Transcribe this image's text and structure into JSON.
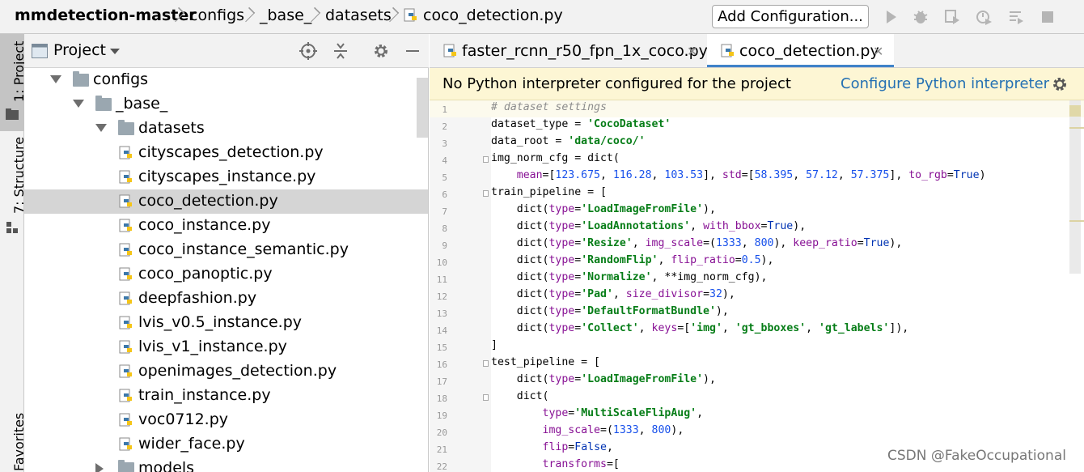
{
  "nav": {
    "crumbs": [
      "mmdetection-master",
      "configs",
      "_base_",
      "datasets",
      "coco_detection.py"
    ],
    "add_configuration": "Add Configuration..."
  },
  "toolbar_icons": [
    "run-icon",
    "debug-icon",
    "coverage-icon",
    "profile-icon",
    "build-icon",
    "stop-icon"
  ],
  "sidebar": {
    "tab_project": "1: Project",
    "tab_structure": "7: Structure",
    "tab_favorites": "Favorites"
  },
  "project": {
    "title": "Project",
    "tree": [
      {
        "label": "configs",
        "type": "folder",
        "expanded": true,
        "depth": 0
      },
      {
        "label": "_base_",
        "type": "folder",
        "expanded": true,
        "depth": 1
      },
      {
        "label": "datasets",
        "type": "folder",
        "expanded": true,
        "depth": 2
      },
      {
        "label": "cityscapes_detection.py",
        "type": "py",
        "depth": 3
      },
      {
        "label": "cityscapes_instance.py",
        "type": "py",
        "depth": 3
      },
      {
        "label": "coco_detection.py",
        "type": "py",
        "depth": 3,
        "selected": true
      },
      {
        "label": "coco_instance.py",
        "type": "py",
        "depth": 3
      },
      {
        "label": "coco_instance_semantic.py",
        "type": "py",
        "depth": 3
      },
      {
        "label": "coco_panoptic.py",
        "type": "py",
        "depth": 3
      },
      {
        "label": "deepfashion.py",
        "type": "py",
        "depth": 3
      },
      {
        "label": "lvis_v0.5_instance.py",
        "type": "py",
        "depth": 3
      },
      {
        "label": "lvis_v1_instance.py",
        "type": "py",
        "depth": 3
      },
      {
        "label": "openimages_detection.py",
        "type": "py",
        "depth": 3
      },
      {
        "label": "train_instance.py",
        "type": "py",
        "depth": 3
      },
      {
        "label": "voc0712.py",
        "type": "py",
        "depth": 3
      },
      {
        "label": "wider_face.py",
        "type": "py",
        "depth": 3
      },
      {
        "label": "models",
        "type": "folder",
        "expanded": false,
        "depth": 2
      }
    ]
  },
  "tabs": [
    {
      "label": "faster_rcnn_r50_fpn_1x_coco.py",
      "active": false
    },
    {
      "label": "coco_detection.py",
      "active": true
    }
  ],
  "banner": {
    "message": "No Python interpreter configured for the project",
    "link": "Configure Python interpreter"
  },
  "code_lines": [
    [
      [
        "c",
        "# dataset settings"
      ]
    ],
    [
      [
        "p",
        "dataset_type = "
      ],
      [
        "s",
        "'CocoDataset'"
      ]
    ],
    [
      [
        "p",
        "data_root = "
      ],
      [
        "s",
        "'data/coco/'"
      ]
    ],
    [
      [
        "p",
        "img_norm_cfg = dict("
      ]
    ],
    [
      [
        "p",
        "    "
      ],
      [
        "k",
        "mean"
      ],
      [
        "p",
        "=["
      ],
      [
        "n",
        "123.675"
      ],
      [
        "p",
        ", "
      ],
      [
        "n",
        "116.28"
      ],
      [
        "p",
        ", "
      ],
      [
        "n",
        "103.53"
      ],
      [
        "p",
        "], "
      ],
      [
        "k",
        "std"
      ],
      [
        "p",
        "=["
      ],
      [
        "n",
        "58.395"
      ],
      [
        "p",
        ", "
      ],
      [
        "n",
        "57.12"
      ],
      [
        "p",
        ", "
      ],
      [
        "n",
        "57.375"
      ],
      [
        "p",
        "], "
      ],
      [
        "k",
        "to_rgb"
      ],
      [
        "p",
        "="
      ],
      [
        "b",
        "True"
      ],
      [
        "p",
        ")"
      ]
    ],
    [
      [
        "p",
        "train_pipeline = ["
      ]
    ],
    [
      [
        "p",
        "    dict("
      ],
      [
        "k",
        "type"
      ],
      [
        "p",
        "="
      ],
      [
        "s",
        "'LoadImageFromFile'"
      ],
      [
        "p",
        "),"
      ]
    ],
    [
      [
        "p",
        "    dict("
      ],
      [
        "k",
        "type"
      ],
      [
        "p",
        "="
      ],
      [
        "s",
        "'LoadAnnotations'"
      ],
      [
        "p",
        ", "
      ],
      [
        "k",
        "with_bbox"
      ],
      [
        "p",
        "="
      ],
      [
        "b",
        "True"
      ],
      [
        "p",
        "),"
      ]
    ],
    [
      [
        "p",
        "    dict("
      ],
      [
        "k",
        "type"
      ],
      [
        "p",
        "="
      ],
      [
        "s",
        "'Resize'"
      ],
      [
        "p",
        ", "
      ],
      [
        "k",
        "img_scale"
      ],
      [
        "p",
        "=("
      ],
      [
        "n",
        "1333"
      ],
      [
        "p",
        ", "
      ],
      [
        "n",
        "800"
      ],
      [
        "p",
        "), "
      ],
      [
        "k",
        "keep_ratio"
      ],
      [
        "p",
        "="
      ],
      [
        "b",
        "True"
      ],
      [
        "p",
        "),"
      ]
    ],
    [
      [
        "p",
        "    dict("
      ],
      [
        "k",
        "type"
      ],
      [
        "p",
        "="
      ],
      [
        "s",
        "'RandomFlip'"
      ],
      [
        "p",
        ", "
      ],
      [
        "k",
        "flip_ratio"
      ],
      [
        "p",
        "="
      ],
      [
        "n",
        "0.5"
      ],
      [
        "p",
        "),"
      ]
    ],
    [
      [
        "p",
        "    dict("
      ],
      [
        "k",
        "type"
      ],
      [
        "p",
        "="
      ],
      [
        "s",
        "'Normalize'"
      ],
      [
        "p",
        ", **img_norm_cfg),"
      ]
    ],
    [
      [
        "p",
        "    dict("
      ],
      [
        "k",
        "type"
      ],
      [
        "p",
        "="
      ],
      [
        "s",
        "'Pad'"
      ],
      [
        "p",
        ", "
      ],
      [
        "k",
        "size_divisor"
      ],
      [
        "p",
        "="
      ],
      [
        "n",
        "32"
      ],
      [
        "p",
        "),"
      ]
    ],
    [
      [
        "p",
        "    dict("
      ],
      [
        "k",
        "type"
      ],
      [
        "p",
        "="
      ],
      [
        "s",
        "'DefaultFormatBundle'"
      ],
      [
        "p",
        "),"
      ]
    ],
    [
      [
        "p",
        "    dict("
      ],
      [
        "k",
        "type"
      ],
      [
        "p",
        "="
      ],
      [
        "s",
        "'Collect'"
      ],
      [
        "p",
        ", "
      ],
      [
        "k",
        "keys"
      ],
      [
        "p",
        "=["
      ],
      [
        "s",
        "'img'"
      ],
      [
        "p",
        ", "
      ],
      [
        "s",
        "'gt_bboxes'"
      ],
      [
        "p",
        ", "
      ],
      [
        "s",
        "'gt_labels'"
      ],
      [
        "p",
        "]),"
      ]
    ],
    [
      [
        "p",
        "]"
      ]
    ],
    [
      [
        "p",
        "test_pipeline = ["
      ]
    ],
    [
      [
        "p",
        "    dict("
      ],
      [
        "k",
        "type"
      ],
      [
        "p",
        "="
      ],
      [
        "s",
        "'LoadImageFromFile'"
      ],
      [
        "p",
        "),"
      ]
    ],
    [
      [
        "p",
        "    dict("
      ]
    ],
    [
      [
        "p",
        "        "
      ],
      [
        "k",
        "type"
      ],
      [
        "p",
        "="
      ],
      [
        "s",
        "'MultiScaleFlipAug'"
      ],
      [
        "p",
        ","
      ]
    ],
    [
      [
        "p",
        "        "
      ],
      [
        "k",
        "img_scale"
      ],
      [
        "p",
        "=("
      ],
      [
        "n",
        "1333"
      ],
      [
        "p",
        ", "
      ],
      [
        "n",
        "800"
      ],
      [
        "p",
        "),"
      ]
    ],
    [
      [
        "p",
        "        "
      ],
      [
        "k",
        "flip"
      ],
      [
        "p",
        "="
      ],
      [
        "b",
        "False"
      ],
      [
        "p",
        ","
      ]
    ],
    [
      [
        "p",
        "        "
      ],
      [
        "k",
        "transforms"
      ],
      [
        "p",
        "=["
      ]
    ]
  ],
  "watermark": "CSDN @FakeOccupational",
  "colors": {
    "accent": "#4083c9",
    "banner_bg": "#fdf6d4",
    "selection": "#d5d5d5",
    "string": "#067d17",
    "number": "#1750eb",
    "keyword_arg": "#871094"
  }
}
